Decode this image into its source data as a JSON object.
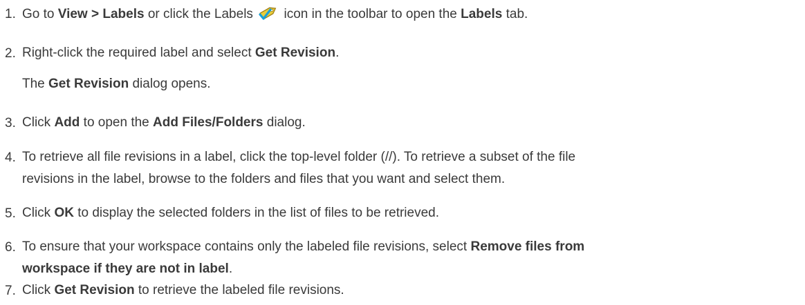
{
  "steps": [
    {
      "number": "1.",
      "parts": [
        "Go to ",
        "View > Labels",
        " or click the Labels ",
        " icon in the toolbar to open the ",
        "Labels",
        " tab."
      ]
    },
    {
      "number": "2.",
      "parts": [
        "Right-click the required label and select ",
        "Get Revision",
        "."
      ],
      "sub": [
        "The ",
        "Get Revision",
        " dialog opens."
      ]
    },
    {
      "number": "3.",
      "parts": [
        "Click ",
        "Add",
        " to open the ",
        "Add Files/Folders",
        " dialog."
      ]
    },
    {
      "number": "4.",
      "lines": [
        "To retrieve all file revisions in a label, click the top-level folder (//). To retrieve a subset of the file",
        "revisions in the label, browse to the folders and files that you want and select them."
      ]
    },
    {
      "number": "5.",
      "parts": [
        "Click ",
        "OK",
        " to display the selected folders in the list of files to be retrieved."
      ]
    },
    {
      "number": "6.",
      "parts": [
        "To ensure that your workspace contains only the labeled file revisions, select ",
        "Remove files from",
        "workspace if they are not in label",
        "."
      ]
    },
    {
      "number": "7.",
      "parts": [
        "Click ",
        "Get Revision",
        " to retrieve the labeled file revisions."
      ]
    }
  ],
  "icons": {
    "labels_toolbar_icon": "label-tag-icon"
  },
  "colors": {
    "text": "#3a3a3a",
    "icon_tag": "#e8cc3a",
    "icon_check": "#1aa0d8"
  }
}
